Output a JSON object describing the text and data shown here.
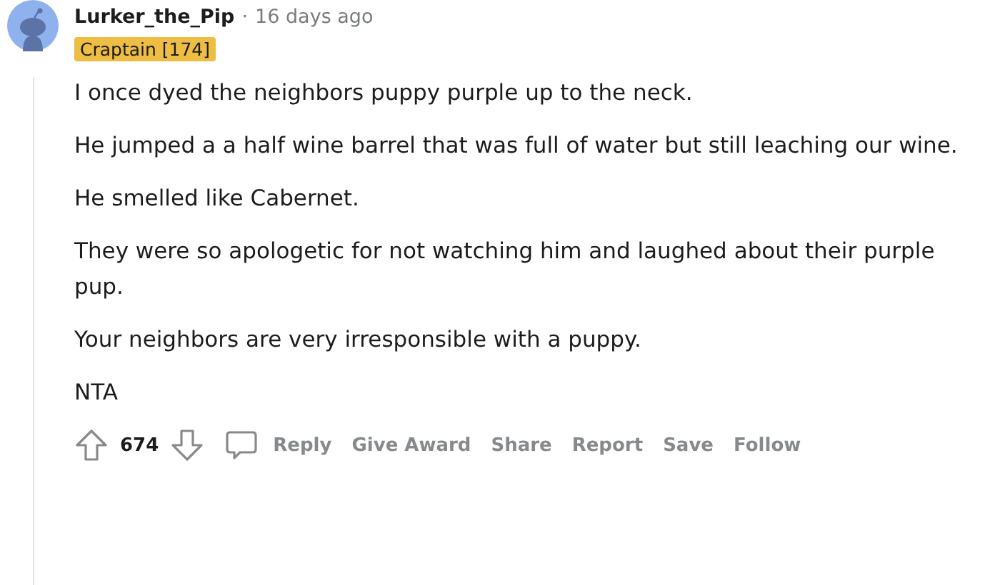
{
  "comment": {
    "author": "Lurker_the_Pip",
    "separator": "·",
    "time": "16 days ago",
    "flair": "Craptain [174]",
    "paragraphs": [
      "I once dyed the neighbors puppy purple up to the neck.",
      "He jumped a a half wine barrel that was full of water but still leaching our wine.",
      "He smelled like Cabernet.",
      "They were so apologetic for not watching him and laughed about their purple pup.",
      "Your neighbors are very irresponsible with a puppy.",
      "NTA"
    ],
    "score": "674",
    "actions": [
      "Reply",
      "Give Award",
      "Share",
      "Report",
      "Save",
      "Follow"
    ]
  }
}
